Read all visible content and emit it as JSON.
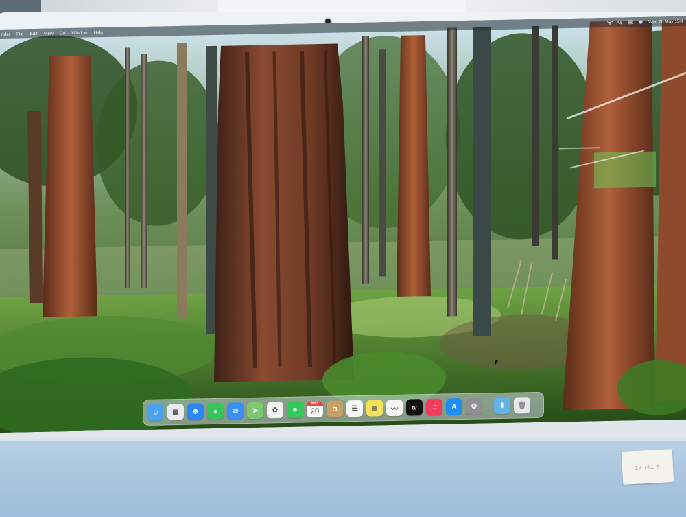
{
  "menubar": {
    "apple_glyph": "",
    "menus": [
      "nder",
      "File",
      "Edit",
      "View",
      "Go",
      "Window",
      "Help"
    ],
    "clock": "Wed 20 May 15:4"
  },
  "dock": {
    "apps": [
      {
        "name": "Finder",
        "color": "#4aa3f0",
        "glyph": "☺"
      },
      {
        "name": "Launchpad",
        "color": "#e6e9ee",
        "glyph": "▦"
      },
      {
        "name": "Safari",
        "color": "#2d86f5",
        "glyph": "⊕"
      },
      {
        "name": "Messages",
        "color": "#35c759",
        "glyph": "●"
      },
      {
        "name": "Mail",
        "color": "#3a8ef6",
        "glyph": "✉"
      },
      {
        "name": "Maps",
        "color": "#7cc86e",
        "glyph": "➤"
      },
      {
        "name": "Photos",
        "color": "#f2f2f2",
        "glyph": "✿"
      },
      {
        "name": "FaceTime",
        "color": "#34c759",
        "glyph": "■"
      },
      {
        "name": "Calendar",
        "month": "MAY",
        "day": "20"
      },
      {
        "name": "Contacts",
        "color": "#c8a066",
        "glyph": "◘"
      },
      {
        "name": "Reminders",
        "color": "#f7f7f7",
        "glyph": "☰"
      },
      {
        "name": "Notes",
        "color": "#f7e25d",
        "glyph": "▤"
      },
      {
        "name": "Freeform",
        "color": "#f4f4f4",
        "glyph": "〰"
      },
      {
        "name": "TV",
        "color": "#111111",
        "glyph": "tv"
      },
      {
        "name": "Music",
        "color": "#f43d5a",
        "glyph": "♫"
      },
      {
        "name": "App Store",
        "color": "#1c8ef5",
        "glyph": "A"
      },
      {
        "name": "System Settings",
        "color": "#8e8e93",
        "glyph": "⚙"
      }
    ],
    "folder": {
      "name": "Downloads",
      "color": "#5fb4e8"
    },
    "trash": {
      "name": "Trash",
      "color": "#e6e9ec"
    }
  },
  "sticker": {
    "text": "17 /41 5"
  }
}
